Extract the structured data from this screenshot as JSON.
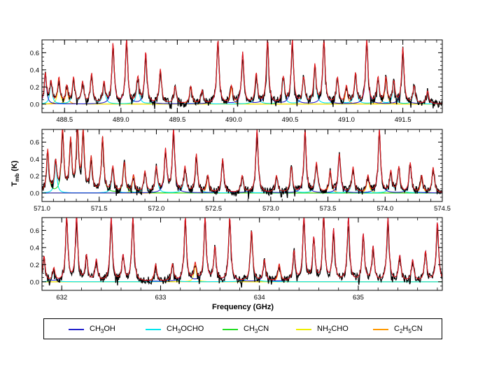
{
  "chart_data": {
    "type": "line",
    "shared_y_label": "T_mb (K)",
    "ylabel_main": "T",
    "ylabel_sub": "mb",
    "ylabel_unit": " (K)",
    "xlabel": "Frequency (GHz)",
    "colors": {
      "observed": "#000000",
      "total_model": "#e41a1c",
      "CH3OH": "#2222cc",
      "CH3OCHO": "#00e5ee",
      "CH3CN": "#22dd22",
      "NH2CHO": "#eeee00",
      "C2H5CN": "#ff9900"
    },
    "panels": [
      {
        "xlim": [
          488.3,
          491.85
        ],
        "ylim": [
          -0.1,
          0.75
        ],
        "xticks": [
          488.5,
          489.0,
          489.5,
          490.0,
          490.5,
          491.0,
          491.5
        ],
        "xtick_labels": [
          "488.5",
          "489.0",
          "489.5",
          "490.0",
          "490.5",
          "491.0",
          "491.5"
        ],
        "yticks": [
          0.0,
          0.2,
          0.4,
          0.6
        ],
        "ytick_labels": [
          "0.0",
          "0.2",
          "0.4",
          "0.6"
        ],
        "lines": [
          {
            "x": 488.33,
            "h": 0.35,
            "s": "CH3OH"
          },
          {
            "x": 488.38,
            "h": 0.25,
            "s": "CH3OCHO"
          },
          {
            "x": 488.45,
            "h": 0.3,
            "s": "NH2CHO"
          },
          {
            "x": 488.52,
            "h": 0.2,
            "s": "C2H5CN"
          },
          {
            "x": 488.58,
            "h": 0.3,
            "s": "CH3OCHO"
          },
          {
            "x": 488.66,
            "h": 0.25,
            "s": "CH3OCHO"
          },
          {
            "x": 488.74,
            "h": 0.35,
            "s": "CH3OCHO"
          },
          {
            "x": 488.85,
            "h": 0.25,
            "s": "CH3OCHO"
          },
          {
            "x": 488.93,
            "h": 0.7,
            "s": "CH3OH"
          },
          {
            "x": 489.05,
            "h": 0.75,
            "s": "CH3OH"
          },
          {
            "x": 489.15,
            "h": 0.3,
            "s": "CH3OCHO"
          },
          {
            "x": 489.22,
            "h": 0.6,
            "s": "CH3OH"
          },
          {
            "x": 489.35,
            "h": 0.4,
            "s": "CH3OCHO"
          },
          {
            "x": 489.48,
            "h": 0.2,
            "s": "CH3OCHO"
          },
          {
            "x": 489.62,
            "h": 0.2,
            "s": "C2H5CN"
          },
          {
            "x": 489.72,
            "h": 0.15,
            "s": "CH3OCHO"
          },
          {
            "x": 489.86,
            "h": 0.75,
            "s": "CH3OH"
          },
          {
            "x": 489.98,
            "h": 0.2,
            "s": "C2H5CN"
          },
          {
            "x": 490.08,
            "h": 0.6,
            "s": "CH3OH"
          },
          {
            "x": 490.2,
            "h": 0.35,
            "s": "CH3OCHO"
          },
          {
            "x": 490.3,
            "h": 0.75,
            "s": "CH3OH"
          },
          {
            "x": 490.44,
            "h": 0.3,
            "s": "CH3OCHO"
          },
          {
            "x": 490.52,
            "h": 0.75,
            "s": "CH3OH"
          },
          {
            "x": 490.62,
            "h": 0.3,
            "s": "CH3OCHO"
          },
          {
            "x": 490.72,
            "h": 0.45,
            "s": "CH3OCHO"
          },
          {
            "x": 490.8,
            "h": 0.75,
            "s": "CH3OH"
          },
          {
            "x": 490.92,
            "h": 0.3,
            "s": "CH3OCHO"
          },
          {
            "x": 491.0,
            "h": 0.2,
            "s": "C2H5CN"
          },
          {
            "x": 491.08,
            "h": 0.35,
            "s": "CH3OCHO"
          },
          {
            "x": 491.18,
            "h": 0.75,
            "s": "CH3OH"
          },
          {
            "x": 491.28,
            "h": 0.3,
            "s": "CH3OCHO"
          },
          {
            "x": 491.35,
            "h": 0.3,
            "s": "C2H5CN"
          },
          {
            "x": 491.42,
            "h": 0.25,
            "s": "CH3OCHO"
          },
          {
            "x": 491.5,
            "h": 0.65,
            "s": "CH3OH"
          },
          {
            "x": 491.6,
            "h": 0.2,
            "s": "CH3OCHO"
          },
          {
            "x": 491.72,
            "h": 0.15,
            "s": "CH3OH"
          }
        ]
      },
      {
        "xlim": [
          571.0,
          574.5
        ],
        "ylim": [
          -0.1,
          0.75
        ],
        "xticks": [
          571.0,
          571.5,
          572.0,
          572.5,
          573.0,
          573.5,
          574.0,
          574.5
        ],
        "xtick_labels": [
          "571.0",
          "571.5",
          "572.0",
          "572.5",
          "573.0",
          "573.5",
          "574.0",
          "574.5"
        ],
        "yticks": [
          0.0,
          0.2,
          0.4,
          0.6
        ],
        "ytick_labels": [
          "0.0",
          "0.2",
          "0.4",
          "0.6"
        ],
        "lines": [
          {
            "x": 571.05,
            "h": 0.5,
            "s": "CH3CN"
          },
          {
            "x": 571.12,
            "h": 0.35,
            "s": "CH3OCHO"
          },
          {
            "x": 571.18,
            "h": 0.75,
            "s": "CH3CN"
          },
          {
            "x": 571.25,
            "h": 0.6,
            "s": "CH3CN"
          },
          {
            "x": 571.31,
            "h": 0.75,
            "s": "CH3CN"
          },
          {
            "x": 571.36,
            "h": 0.7,
            "s": "CH3CN"
          },
          {
            "x": 571.43,
            "h": 0.4,
            "s": "CH3CN"
          },
          {
            "x": 571.53,
            "h": 0.65,
            "s": "CH3CN"
          },
          {
            "x": 571.62,
            "h": 0.3,
            "s": "CH3OCHO"
          },
          {
            "x": 571.72,
            "h": 0.35,
            "s": "CH3CN"
          },
          {
            "x": 571.8,
            "h": 0.2,
            "s": "NH2CHO"
          },
          {
            "x": 571.9,
            "h": 0.25,
            "s": "CH3OCHO"
          },
          {
            "x": 572.0,
            "h": 0.3,
            "s": "CH3OCHO"
          },
          {
            "x": 572.08,
            "h": 0.5,
            "s": "CH3OH"
          },
          {
            "x": 572.15,
            "h": 0.75,
            "s": "CH3OH"
          },
          {
            "x": 572.25,
            "h": 0.3,
            "s": "CH3OCHO"
          },
          {
            "x": 572.35,
            "h": 0.45,
            "s": "CH3OCHO"
          },
          {
            "x": 572.45,
            "h": 0.2,
            "s": "C2H5CN"
          },
          {
            "x": 572.58,
            "h": 0.4,
            "s": "CH3OH"
          },
          {
            "x": 572.75,
            "h": 0.2,
            "s": "CH3OCHO"
          },
          {
            "x": 572.88,
            "h": 0.75,
            "s": "CH3OH"
          },
          {
            "x": 573.05,
            "h": 0.2,
            "s": "CH3OCHO"
          },
          {
            "x": 573.18,
            "h": 0.3,
            "s": "CH3OCHO"
          },
          {
            "x": 573.3,
            "h": 0.75,
            "s": "CH3OH"
          },
          {
            "x": 573.4,
            "h": 0.35,
            "s": "CH3OCHO"
          },
          {
            "x": 573.52,
            "h": 0.25,
            "s": "C2H5CN"
          },
          {
            "x": 573.6,
            "h": 0.45,
            "s": "CH3OH"
          },
          {
            "x": 573.72,
            "h": 0.3,
            "s": "CH3OCHO"
          },
          {
            "x": 573.85,
            "h": 0.2,
            "s": "NH2CHO"
          },
          {
            "x": 573.95,
            "h": 0.75,
            "s": "CH3OH"
          },
          {
            "x": 574.05,
            "h": 0.25,
            "s": "CH3OCHO"
          },
          {
            "x": 574.12,
            "h": 0.3,
            "s": "CH3OCHO"
          },
          {
            "x": 574.22,
            "h": 0.35,
            "s": "CH3OH"
          },
          {
            "x": 574.32,
            "h": 0.2,
            "s": "C2H5CN"
          },
          {
            "x": 574.42,
            "h": 0.3,
            "s": "CH3OCHO"
          }
        ]
      },
      {
        "xlim": [
          631.8,
          635.85
        ],
        "ylim": [
          -0.1,
          0.75
        ],
        "xticks": [
          632,
          633,
          634,
          635
        ],
        "xtick_labels": [
          "632",
          "633",
          "634",
          "635"
        ],
        "yticks": [
          0.0,
          0.2,
          0.4,
          0.6
        ],
        "ytick_labels": [
          "0.0",
          "0.2",
          "0.4",
          "0.6"
        ],
        "lines": [
          {
            "x": 631.82,
            "h": 0.3,
            "s": "CH3OH"
          },
          {
            "x": 631.92,
            "h": 0.15,
            "s": "CH3OCHO"
          },
          {
            "x": 632.05,
            "h": 0.75,
            "s": "CH3OH"
          },
          {
            "x": 632.15,
            "h": 0.75,
            "s": "CH3OH"
          },
          {
            "x": 632.25,
            "h": 0.3,
            "s": "CH3OH"
          },
          {
            "x": 632.35,
            "h": 0.25,
            "s": "CH3OH"
          },
          {
            "x": 632.5,
            "h": 0.75,
            "s": "CH3OH"
          },
          {
            "x": 632.62,
            "h": 0.3,
            "s": "CH3OH"
          },
          {
            "x": 632.72,
            "h": 0.75,
            "s": "CH3OH"
          },
          {
            "x": 632.95,
            "h": 0.2,
            "s": "C2H5CN"
          },
          {
            "x": 633.12,
            "h": 0.2,
            "s": "CH3OCHO"
          },
          {
            "x": 633.25,
            "h": 0.75,
            "s": "CH3OH"
          },
          {
            "x": 633.35,
            "h": 0.2,
            "s": "NH2CHO"
          },
          {
            "x": 633.45,
            "h": 0.75,
            "s": "CH3OH"
          },
          {
            "x": 633.55,
            "h": 0.4,
            "s": "CH3OH"
          },
          {
            "x": 633.7,
            "h": 0.75,
            "s": "CH3OH"
          },
          {
            "x": 633.92,
            "h": 0.6,
            "s": "CH3OCHO"
          },
          {
            "x": 634.05,
            "h": 0.25,
            "s": "CH3OH"
          },
          {
            "x": 634.2,
            "h": 0.2,
            "s": "C2H5CN"
          },
          {
            "x": 634.35,
            "h": 0.35,
            "s": "CH3OH"
          },
          {
            "x": 634.45,
            "h": 0.75,
            "s": "CH3OH"
          },
          {
            "x": 634.55,
            "h": 0.5,
            "s": "CH3OH"
          },
          {
            "x": 634.65,
            "h": 0.75,
            "s": "CH3OH"
          },
          {
            "x": 634.75,
            "h": 0.6,
            "s": "CH3OH"
          },
          {
            "x": 634.9,
            "h": 0.75,
            "s": "CH3OH"
          },
          {
            "x": 635.05,
            "h": 0.55,
            "s": "CH3OH"
          },
          {
            "x": 635.15,
            "h": 0.4,
            "s": "CH3OH"
          },
          {
            "x": 635.3,
            "h": 0.75,
            "s": "CH3OH"
          },
          {
            "x": 635.42,
            "h": 0.3,
            "s": "CH3OH"
          },
          {
            "x": 635.55,
            "h": 0.25,
            "s": "CH3OH"
          },
          {
            "x": 635.68,
            "h": 0.35,
            "s": "CH3OH"
          },
          {
            "x": 635.8,
            "h": 0.7,
            "s": "CH3OH"
          }
        ]
      }
    ],
    "legend": [
      {
        "key": "CH3OH",
        "pre": "CH",
        "sub": "3",
        "post": "OH"
      },
      {
        "key": "CH3OCHO",
        "pre": "CH",
        "sub": "3",
        "post": "OCHO"
      },
      {
        "key": "CH3CN",
        "pre": "CH",
        "sub": "3",
        "post": "CN"
      },
      {
        "key": "NH2CHO",
        "pre": "NH",
        "sub": "2",
        "post": "CHO"
      },
      {
        "key": "C2H5CN",
        "pre": "C",
        "sub": "2",
        "mid": "H",
        "sub2": "5",
        "post": "CN"
      }
    ]
  }
}
